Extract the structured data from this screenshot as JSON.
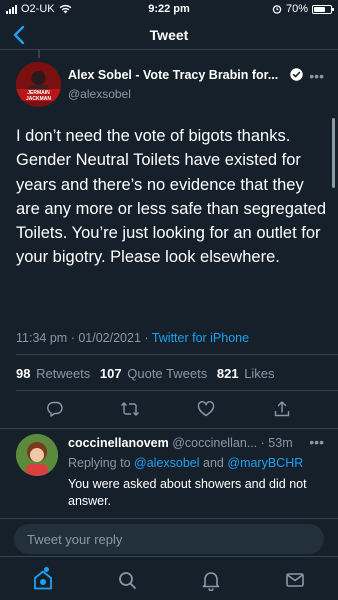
{
  "status_bar": {
    "carrier": "O2-UK",
    "time": "9:22 pm",
    "battery": "70%",
    "battery_level": 0.7
  },
  "nav": {
    "title": "Tweet",
    "back_icon": "chevron-left-icon"
  },
  "tweet": {
    "author_name": "Alex Sobel - Vote Tracy Brabin for...",
    "author_handle": "@alexsobel",
    "avatar_caption": "JERMAIN JACKMAN",
    "text": "I don’t need the vote of bigots thanks. Gender Neutral Toilets have existed for years and there’s no evidence that they are any more or less safe than segregated Toilets. You’re just looking for an outlet for your bigotry. Please look elsewhere.",
    "time": "11:34 pm",
    "separator": "·",
    "date": "01/02/2021",
    "source": "Twitter for iPhone",
    "retweets_count": "98",
    "retweets_label": "Retweets",
    "quotes_count": "107",
    "quotes_label": "Quote Tweets",
    "likes_count": "821",
    "likes_label": "Likes"
  },
  "reply": {
    "name": "coccinellanovem",
    "handle": "@coccinellan...",
    "time": "· 53m",
    "replying_prefix": "Replying to",
    "replying_user1": "@alexsobel",
    "replying_and": "and",
    "replying_user2": "@maryBCHR",
    "text": "You were asked about showers and did not answer."
  },
  "compose": {
    "placeholder": "Tweet your reply"
  },
  "colors": {
    "background": "#15202b",
    "accent": "#1da1f2",
    "muted": "#8899a6",
    "divider": "#38444d"
  }
}
